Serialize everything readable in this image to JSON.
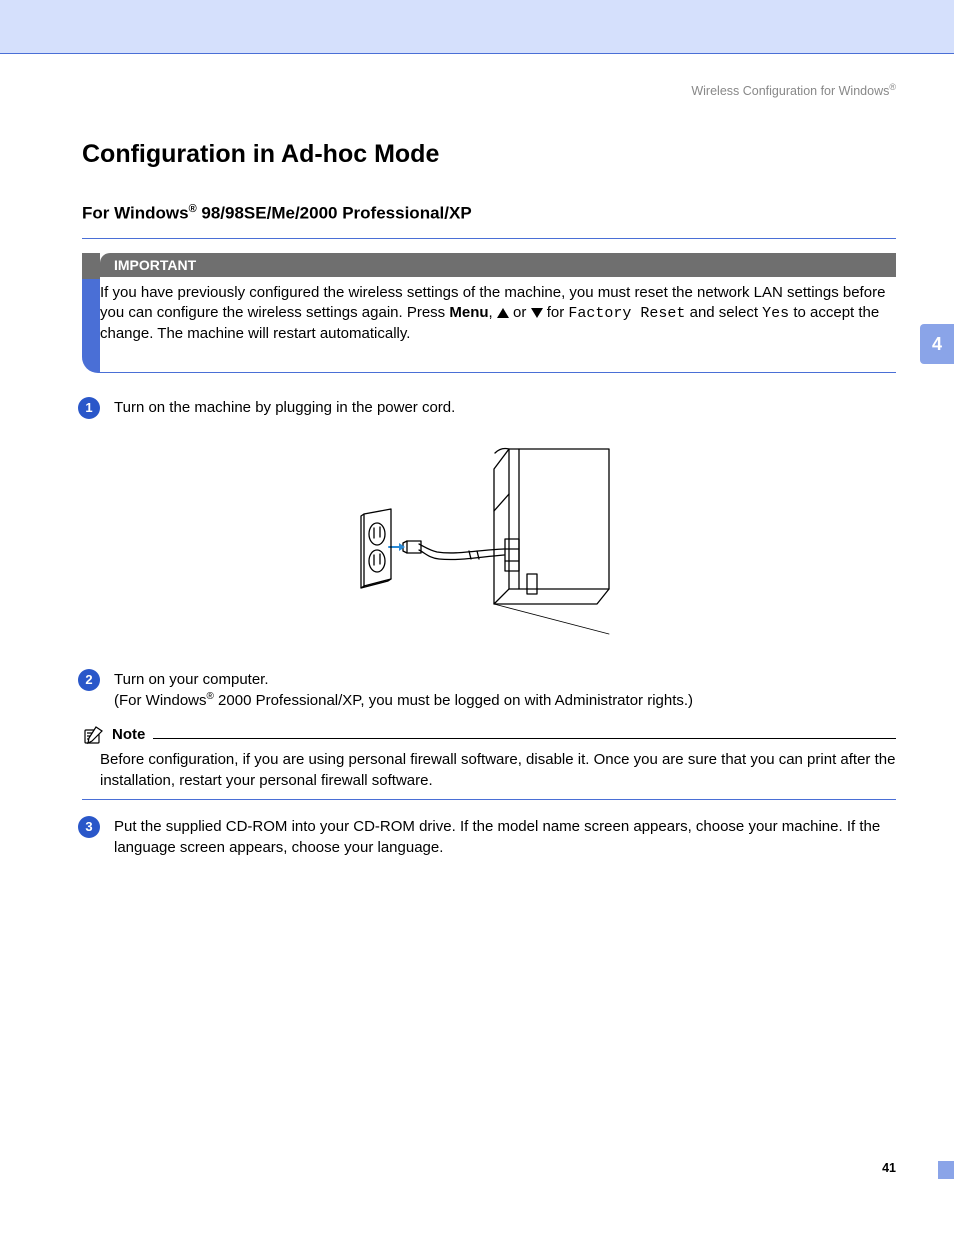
{
  "breadcrumb": {
    "text": "Wireless Configuration for Windows",
    "sup": "®"
  },
  "chapter_tab": "4",
  "h1": "Configuration in Ad-hoc Mode",
  "h2_pre": "For Windows",
  "h2_sup": "®",
  "h2_post": " 98/98SE/Me/2000 Professional/XP",
  "important": {
    "label": "IMPORTANT",
    "line1": "If you have previously configured the wireless settings of the machine, you must reset the network LAN settings before you can configure the wireless settings again. Press ",
    "menu": "Menu",
    "comma": ", ",
    "or": " or ",
    "for": " for ",
    "factory_reset": "Factory Reset",
    "line2_a": " and select ",
    "yes": "Yes",
    "line2_b": " to accept the change. The machine will restart automatically."
  },
  "steps": {
    "s1_num": "1",
    "s1_text": "Turn on the machine by plugging in the power cord.",
    "s2_num": "2",
    "s2_line1": "Turn on your computer.",
    "s2_line2_a": "(For Windows",
    "s2_sup": "®",
    "s2_line2_b": " 2000 Professional/XP, you must be logged on with Administrator rights.)",
    "s3_num": "3",
    "s3_text": "Put the supplied CD-ROM into your CD-ROM drive. If the model name screen appears, choose your machine. If the language screen appears, choose your language."
  },
  "note": {
    "label": "Note",
    "body": "Before configuration, if you are using personal firewall software, disable it. Once you are sure that you can print after the installation, restart your personal firewall software."
  },
  "page_number": "41"
}
